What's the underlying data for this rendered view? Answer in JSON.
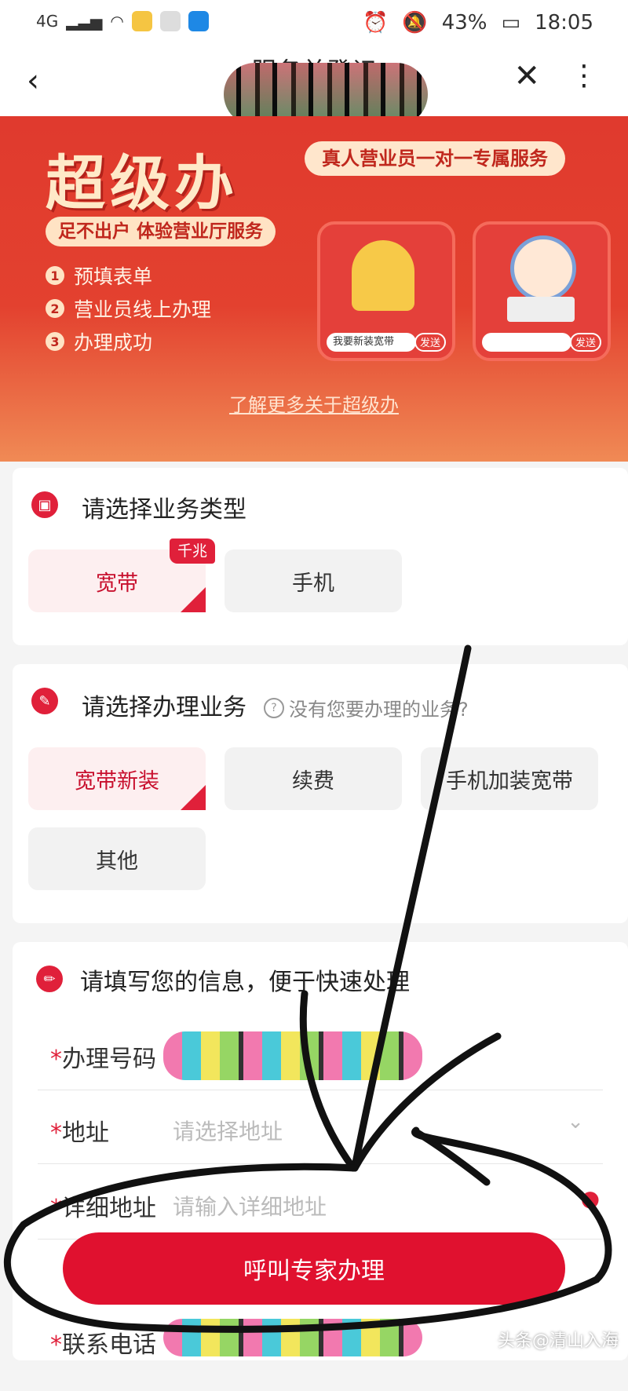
{
  "status_bar": {
    "network": "4G",
    "battery": "43%",
    "time": "18:05"
  },
  "nav": {
    "title": "服务单登记"
  },
  "banner": {
    "title": "超级办",
    "slogan": "足不出户 体验营业厅服务",
    "steps": [
      "预填表单",
      "营业员线上办理",
      "办理成功"
    ],
    "service_tagline": "真人营业员一对一专属服务",
    "card1_field": "我要新装宽带",
    "card_send": "发送",
    "learn_more": "了解更多关于超级办"
  },
  "business_type": {
    "title": "请选择业务类型",
    "options": [
      "宽带",
      "手机"
    ],
    "selected": "宽带",
    "badge": "千兆"
  },
  "handle_business": {
    "title": "请选择办理业务",
    "hint": "没有您要办理的业务?",
    "options": [
      "宽带新装",
      "续费",
      "手机加装宽带",
      "其他"
    ],
    "selected": "宽带新装"
  },
  "info_form": {
    "title": "请填写您的信息，便于快速处理",
    "fields": [
      {
        "label": "办理号码",
        "value": ""
      },
      {
        "label": "地址",
        "placeholder": "请选择地址"
      },
      {
        "label": "详细地址",
        "placeholder": "请输入详细地址"
      },
      {
        "label": "联系电话",
        "value": ""
      }
    ],
    "required_mark": "*"
  },
  "cta": {
    "label": "呼叫专家办理"
  },
  "watermark": "头条@清山入海",
  "colors": {
    "brand_red": "#e0112f",
    "banner_top": "#e03a2e",
    "banner_bottom": "#f08a55",
    "selected_bg": "#fdeff0"
  }
}
